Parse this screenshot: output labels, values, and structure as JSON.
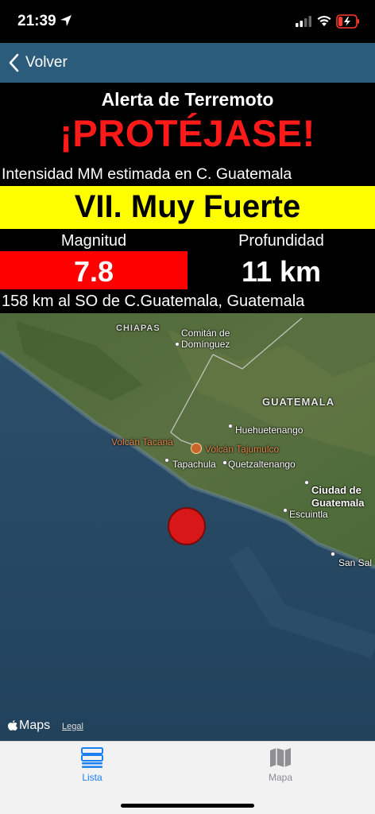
{
  "status_bar": {
    "time": "21:39",
    "location_icon": "location-arrow-icon",
    "signal_icon": "cellular-signal-icon",
    "wifi_icon": "wifi-icon",
    "battery_icon": "battery-charging-icon"
  },
  "nav": {
    "back_label": "Volver",
    "back_icon": "chevron-left-icon",
    "bar_color": "#2b5c7c"
  },
  "alert": {
    "title": "Alerta de Terremoto",
    "headline": "¡PROTÉJASE!",
    "headline_color": "#ff1a1a",
    "intensity_label": "Intensidad MM estimada en C. Guatemala",
    "intensity_value": "VII. Muy Fuerte",
    "intensity_color": "#ffff00",
    "magnitude_label": "Magnitud",
    "magnitude_value": "7.8",
    "magnitude_color": "#ff0000",
    "depth_label": "Profundidad",
    "depth_value": "11 km",
    "distance": "158 km al SO de C.Guatemala, Guatemala"
  },
  "map": {
    "labels": {
      "chiapas": "CHIAPAS",
      "comitan": "Comitán de Domínguez",
      "guatemala": "GUATEMALA",
      "huehuetenango": "Huehuetenango",
      "volcan_tacana": "Volcán Tacaná",
      "volcan_tajumulco": "Volcán Tajumulco",
      "tapachula": "Tapachula",
      "quetzaltenango": "Quetzaltenango",
      "ciudad": "Ciudad de",
      "guatemala_city": "Guatemala",
      "escuintla": "Escuintla",
      "san_sal": "San Sal"
    },
    "maps_logo": "Maps",
    "legal": "Legal",
    "quake_marker_color": "#d81818"
  },
  "tabs": [
    {
      "label": "Lista",
      "icon": "list-icon",
      "active": true
    },
    {
      "label": "Mapa",
      "icon": "map-icon",
      "active": false
    }
  ]
}
